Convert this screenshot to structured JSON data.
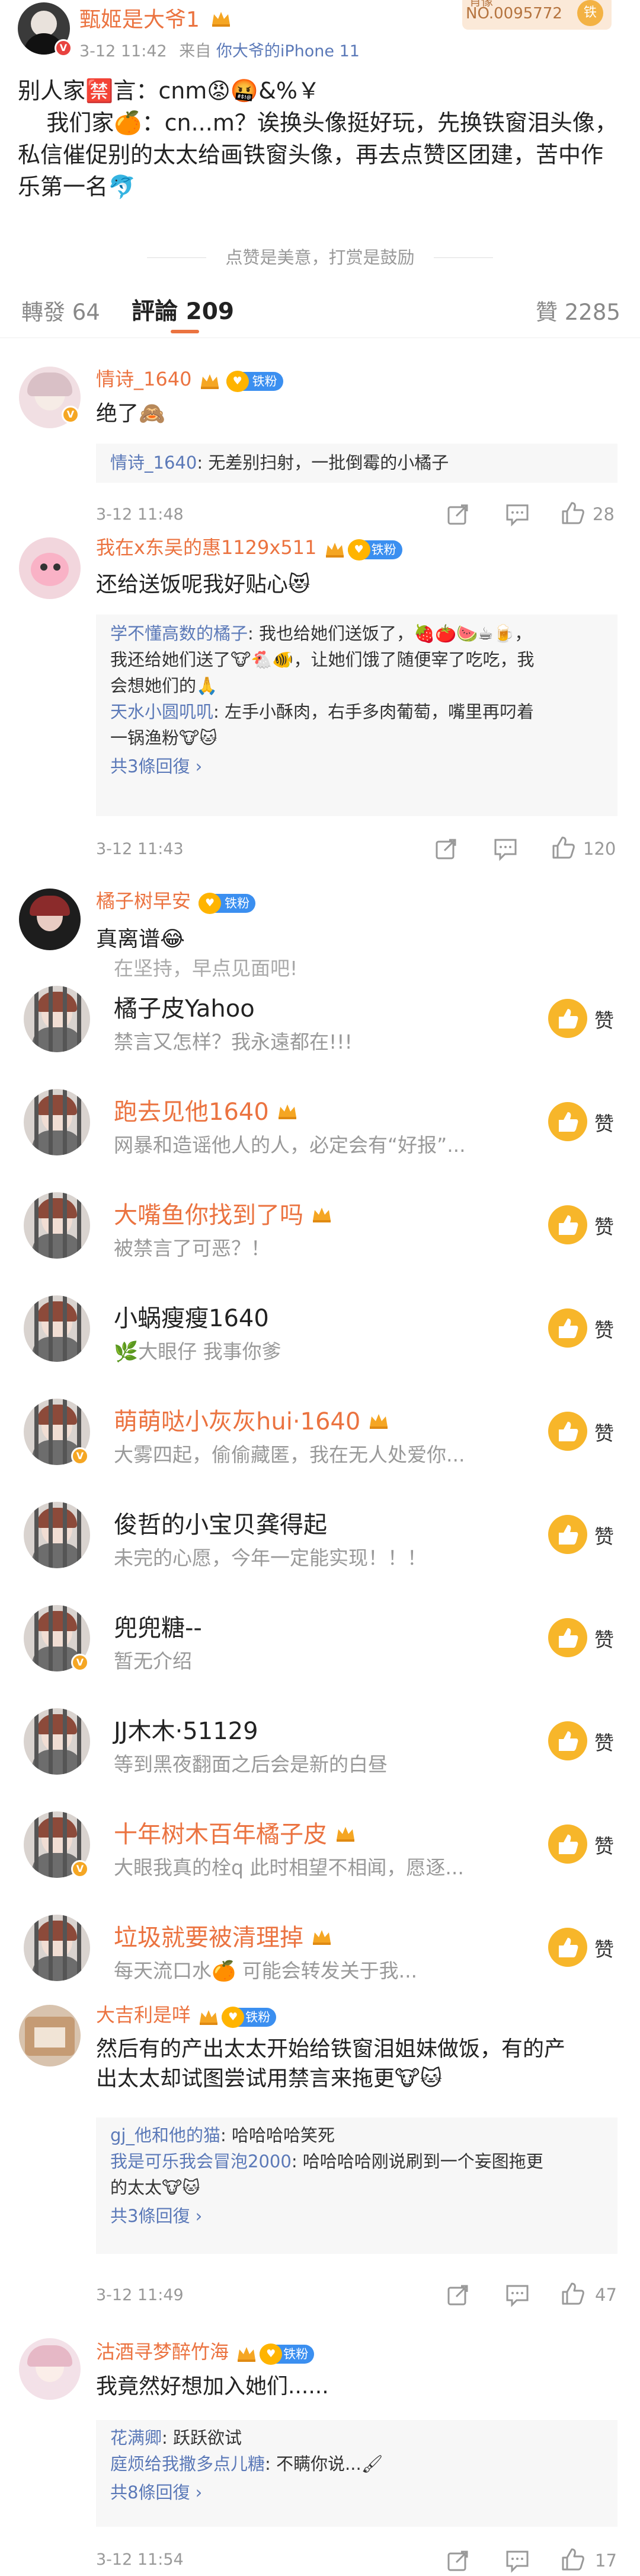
{
  "post": {
    "author": "甄姬是大爷1",
    "time": "3-12 11:42",
    "source_prefix": "来自",
    "source": "你大爷的iPhone 11",
    "card_top": "肖像",
    "card_no": "NO.0095772",
    "card_tag": "铁",
    "line1": "别人家🈲言：cnm😡🤬&%￥",
    "line2": "    我们家🍊：cn...m？诶换头像挺好玩，先换铁窗泪头像，",
    "line3": "私信催促别的太太给画铁窗头像，再去点赞区团建，苦中作",
    "line4": "乐第一名🐬",
    "divider_text": "点赞是美意，打赏是鼓励"
  },
  "tabs": {
    "reposts": "轉發 64",
    "comments": "評論 209",
    "likes": "贊 2285"
  },
  "fan_badge": "铁粉",
  "comments": [
    {
      "name": "情诗_1640",
      "text": "绝了🙈",
      "replies": [
        {
          "user": "情诗_1640",
          "text": ": 无差别扫射，一批倒霉的小橘子"
        }
      ],
      "more": "",
      "time": "3-12 11:48",
      "likes": "28"
    },
    {
      "name": "我在x东吴的惠1129x511",
      "text": "还给送饭呢我好贴心😻",
      "replies": [
        {
          "user": "学不懂高数的橘子",
          "text": ": 我也给她们送饭了，🍓🍅🍉☕🍺，"
        },
        {
          "user": "",
          "text": "我还给她们送了🐮🐔🐠，让她们饿了随便宰了吃吃，我"
        },
        {
          "user": "",
          "text": "会想她们的🙏"
        },
        {
          "user": "天水小圆叽叽",
          "text": ": 左手小酥肉，右手多肉葡萄，嘴里再叼着"
        },
        {
          "user": "",
          "text": "一锅渔粉🐮🐱"
        }
      ],
      "more": "共3條回復 ›",
      "time": "3-12 11:43",
      "likes": "120"
    },
    {
      "name": "橘子树早安",
      "text": "真离谱😂",
      "overflow_text": "在坚持，早点见面吧!"
    }
  ],
  "rank_list": [
    {
      "name": "橘子皮Yahoo",
      "sub": "禁言又怎样？我永遠都在!!!",
      "orange": false,
      "crown": false,
      "vip": false,
      "zan": "赞"
    },
    {
      "name": "跑去见他1640",
      "sub": "网暴和造谣他人的人，必定会有“好报”...",
      "orange": true,
      "crown": true,
      "vip": false,
      "zan": "赞"
    },
    {
      "name": "大嘴鱼你找到了吗",
      "sub": "被禁言了可恶？！",
      "orange": true,
      "crown": true,
      "vip": false,
      "zan": "赞"
    },
    {
      "name": "小蜗瘦瘦1640",
      "sub": "🌿大眼仔 我事你爹",
      "orange": false,
      "crown": false,
      "vip": false,
      "zan": "赞"
    },
    {
      "name": "萌萌哒小灰灰hui·1640",
      "sub": "大雾四起，偷偷藏匿，我在无人处爱你...",
      "orange": true,
      "crown": true,
      "vip": true,
      "zan": "赞"
    },
    {
      "name": "俊哲的小宝贝龚得起",
      "sub": "未完的心愿，今年一定能实现！！！",
      "orange": false,
      "crown": false,
      "vip": false,
      "zan": "赞"
    },
    {
      "name": "兜兜糖--",
      "sub": "暂无介绍",
      "orange": false,
      "crown": false,
      "vip": true,
      "zan": "赞"
    },
    {
      "name": "JJ木木·51129",
      "sub": "等到黑夜翻面之后会是新的白昼",
      "orange": false,
      "crown": false,
      "vip": false,
      "zan": "赞"
    },
    {
      "name": "十年树木百年橘子皮",
      "sub": "大眼我真的栓q    此时相望不相闻，愿逐...",
      "orange": true,
      "crown": true,
      "vip": true,
      "zan": "赞"
    },
    {
      "name": "垃圾就要被清理掉",
      "sub": "每天流口水🍊      可能会转发关于我...",
      "orange": true,
      "crown": true,
      "vip": false,
      "zan": "赞"
    }
  ],
  "comments2": [
    {
      "name": "大吉利是咩",
      "line1": "然后有的产出太太开始给铁窗泪姐妹做饭，有的产",
      "line2": "出太太却试图尝试用禁言来拖更🐮🐱",
      "replies": [
        {
          "user": "gj_他和他的猫",
          "text": ": 哈哈哈哈笑死"
        },
        {
          "user": "我是可乐我会冒泡2000",
          "text": ": 哈哈哈哈刚说刷到一个妄图拖更"
        },
        {
          "user": "",
          "text": "的太太🐮🐱"
        }
      ],
      "more": "共3條回復 ›",
      "time": "3-12 11:49",
      "likes": "47"
    },
    {
      "name": "沽酒寻梦醉竹海",
      "line1": "我竟然好想加入她们......",
      "line2": "",
      "replies": [
        {
          "user": "花满卿",
          "text": ": 跃跃欲试"
        },
        {
          "user": "庭烦给我撒多点儿糖",
          "text": ": 不瞒你说...🖌"
        }
      ],
      "more": "共8條回復 ›",
      "time": "3-12 11:54",
      "likes": "17"
    }
  ],
  "colors": {
    "accent": "#eb7340",
    "link": "#5b79b8",
    "badge": "#3b8ff0",
    "gold": "#f7b62a"
  }
}
